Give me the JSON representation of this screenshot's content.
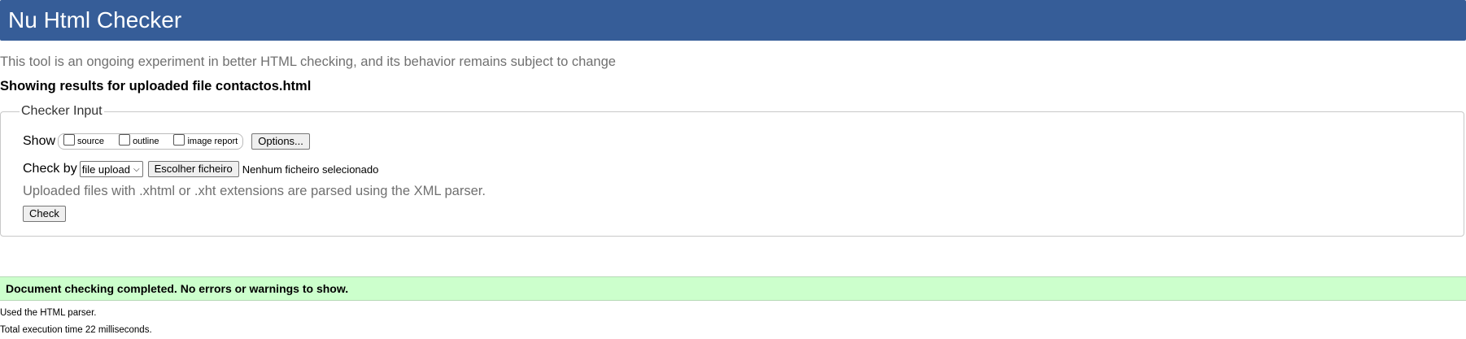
{
  "header": {
    "title": "Nu Html Checker"
  },
  "intro_text": "This tool is an ongoing experiment in better HTML checking, and its behavior remains subject to change",
  "results_heading": "Showing results for uploaded file contactos.html",
  "checker_input": {
    "legend": "Checker Input",
    "show": {
      "label": "Show",
      "options": [
        {
          "label": "source",
          "checked": false
        },
        {
          "label": "outline",
          "checked": false
        },
        {
          "label": "image report",
          "checked": false
        }
      ],
      "options_button": "Options..."
    },
    "check_by": {
      "label": "Check by",
      "selected": "file upload",
      "file_button": "Escolher ficheiro",
      "file_status": "Nenhum ficheiro selecionado"
    },
    "xml_note": "Uploaded files with .xhtml or .xht extensions are parsed using the XML parser.",
    "check_button": "Check"
  },
  "result": {
    "message": "Document checking completed. No errors or warnings to show.",
    "parser_note": "Used the HTML parser.",
    "execution_time": "Total execution time 22 milliseconds."
  },
  "colors": {
    "header_bg": "#365d98",
    "success_bg": "#ccffcc",
    "muted_text": "#707070"
  }
}
